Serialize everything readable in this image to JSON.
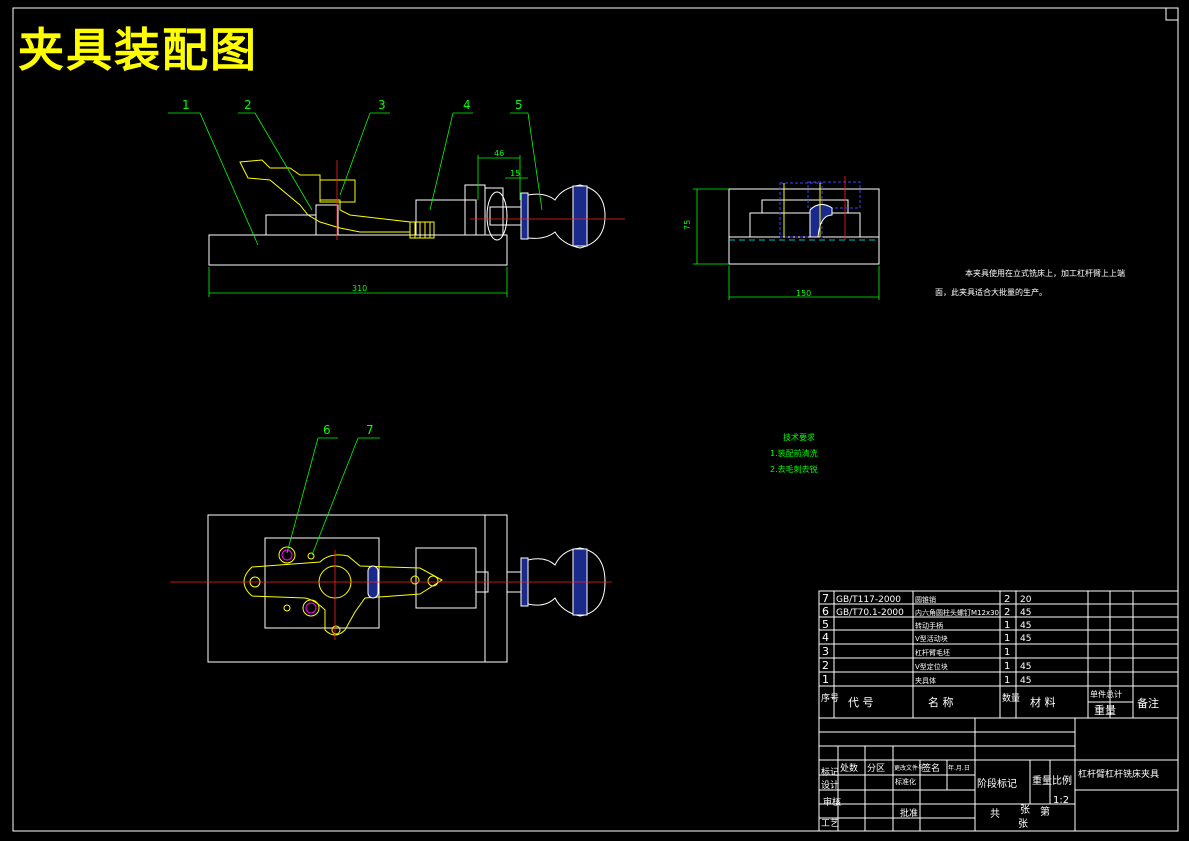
{
  "title": "夹具装配图",
  "views": {
    "front": {
      "balloons": [
        "1",
        "2",
        "3",
        "4",
        "5"
      ],
      "dims": {
        "overall": "310",
        "d46": "46",
        "d15": "15"
      }
    },
    "side": {
      "dims": {
        "height": "75",
        "width": "150"
      }
    },
    "top": {
      "balloons": [
        "6",
        "7"
      ]
    }
  },
  "notes": {
    "line1": "本夹具使用在立式铣床上，加工杠杆臂上上端",
    "line2": "面，此夹具适合大批量的生产。"
  },
  "requirements": {
    "heading": "技术要求",
    "item1": "1.装配前清洗",
    "item2": "2.去毛刺去锐"
  },
  "bom": {
    "rows": [
      {
        "seq": "7",
        "code": "GB/T117-2000",
        "name": "圆锥销",
        "qty": "2",
        "material": "20"
      },
      {
        "seq": "6",
        "code": "GB/T70.1-2000",
        "name": "内六角圆柱头螺钉M12x30",
        "qty": "2",
        "material": "45"
      },
      {
        "seq": "5",
        "code": "",
        "name": "转动手柄",
        "qty": "1",
        "material": "45"
      },
      {
        "seq": "4",
        "code": "",
        "name": "V型活动块",
        "qty": "1",
        "material": "45"
      },
      {
        "seq": "3",
        "code": "",
        "name": "杠杆臂毛坯",
        "qty": "1",
        "material": ""
      },
      {
        "seq": "2",
        "code": "",
        "name": "V型定位块",
        "qty": "1",
        "material": "45"
      },
      {
        "seq": "1",
        "code": "",
        "name": "夹具体",
        "qty": "1",
        "material": "45"
      }
    ],
    "header": {
      "seq": "序号",
      "code": "代  号",
      "name": "名  称",
      "qty": "数量",
      "material": "材  料",
      "unit": "单件总计",
      "weight": "重量",
      "remark": "备注"
    }
  },
  "titleblock": {
    "mark": "标记",
    "count": "处数",
    "zone": "分区",
    "docno": "更改文件号",
    "sign": "签名",
    "date": "年.月.日",
    "design": "设计",
    "standard": "标准化",
    "check": "审核",
    "process": "工艺",
    "approve": "批准",
    "stage": "阶段标记",
    "weight": "重量",
    "scale_label": "比例",
    "scale": "1:2",
    "total": "共",
    "sheets": "张",
    "page": "第",
    "page_sheets": "张",
    "drawing_name": "杠杆臂杠杆铣床夹具"
  }
}
